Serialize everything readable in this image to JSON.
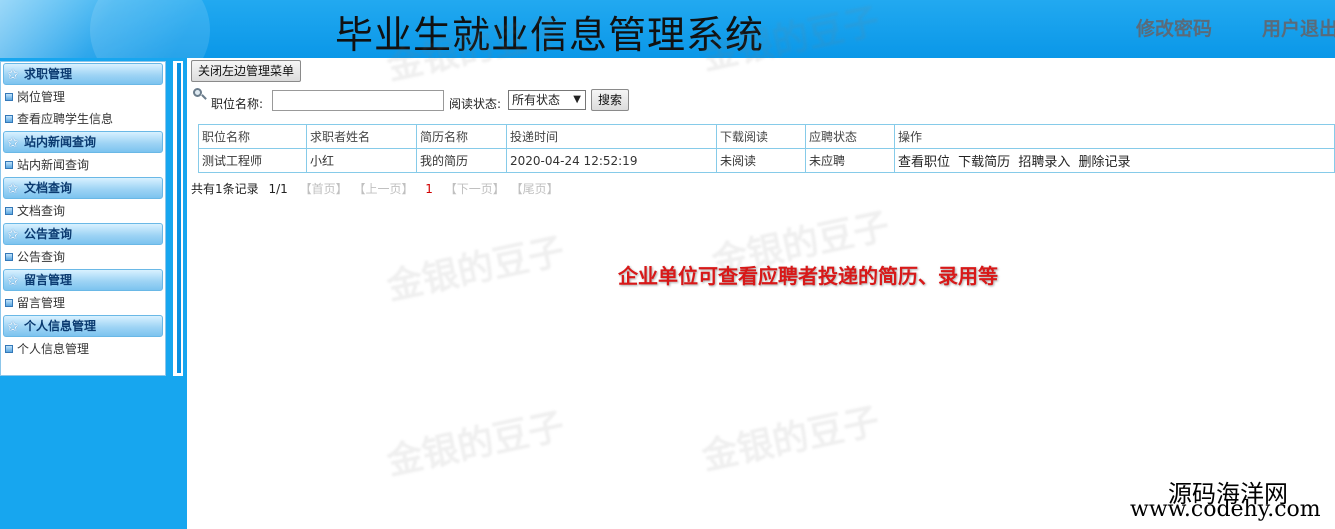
{
  "header": {
    "title": "毕业生就业信息管理系统",
    "links": [
      "修改密码",
      "用户退出"
    ]
  },
  "sidebar": {
    "sections": [
      {
        "label": "求职管理",
        "items": [
          "岗位管理",
          "查看应聘学生信息"
        ]
      },
      {
        "label": "站内新闻查询",
        "items": [
          "站内新闻查询"
        ]
      },
      {
        "label": "文档查询",
        "items": [
          "文档查询"
        ]
      },
      {
        "label": "公告查询",
        "items": [
          "公告查询"
        ]
      },
      {
        "label": "留言管理",
        "items": [
          "留言管理"
        ]
      },
      {
        "label": "个人信息管理",
        "items": [
          "个人信息管理"
        ]
      }
    ]
  },
  "toolbar": {
    "close_menu_label": "关闭左边管理菜单"
  },
  "search": {
    "job_name_label": "职位名称:",
    "job_name_value": "",
    "status_label": "阅读状态:",
    "status_selected": "所有状态",
    "search_button": "搜索"
  },
  "table": {
    "headers": [
      "职位名称",
      "求职者姓名",
      "简历名称",
      "投递时间",
      "下载阅读",
      "应聘状态",
      "操作"
    ],
    "rows": [
      {
        "job": "测试工程师",
        "applicant": "小红",
        "resume": "我的简历",
        "time": "2020-04-24 12:52:19",
        "read": "未阅读",
        "status": "未应聘",
        "ops": [
          "查看职位",
          "下载简历",
          "招聘录入",
          "删除记录"
        ]
      }
    ]
  },
  "pager": {
    "summary": "共有1条记录",
    "page_info": "1/1",
    "first": "【首页】",
    "prev": "【上一页】",
    "current": "1",
    "next": "【下一页】",
    "last": "【尾页】"
  },
  "annotation": "企业单位可查看应聘者投递的简历、录用等",
  "watermark": "金银的豆子",
  "site": {
    "name": "源码海洋网",
    "url": "www.codehy.com"
  },
  "colors": {
    "header_bg": "#0a97e8",
    "sidebar_bg": "#17a6ef",
    "annotation": "#d81818",
    "table_border": "#86cbe9"
  }
}
